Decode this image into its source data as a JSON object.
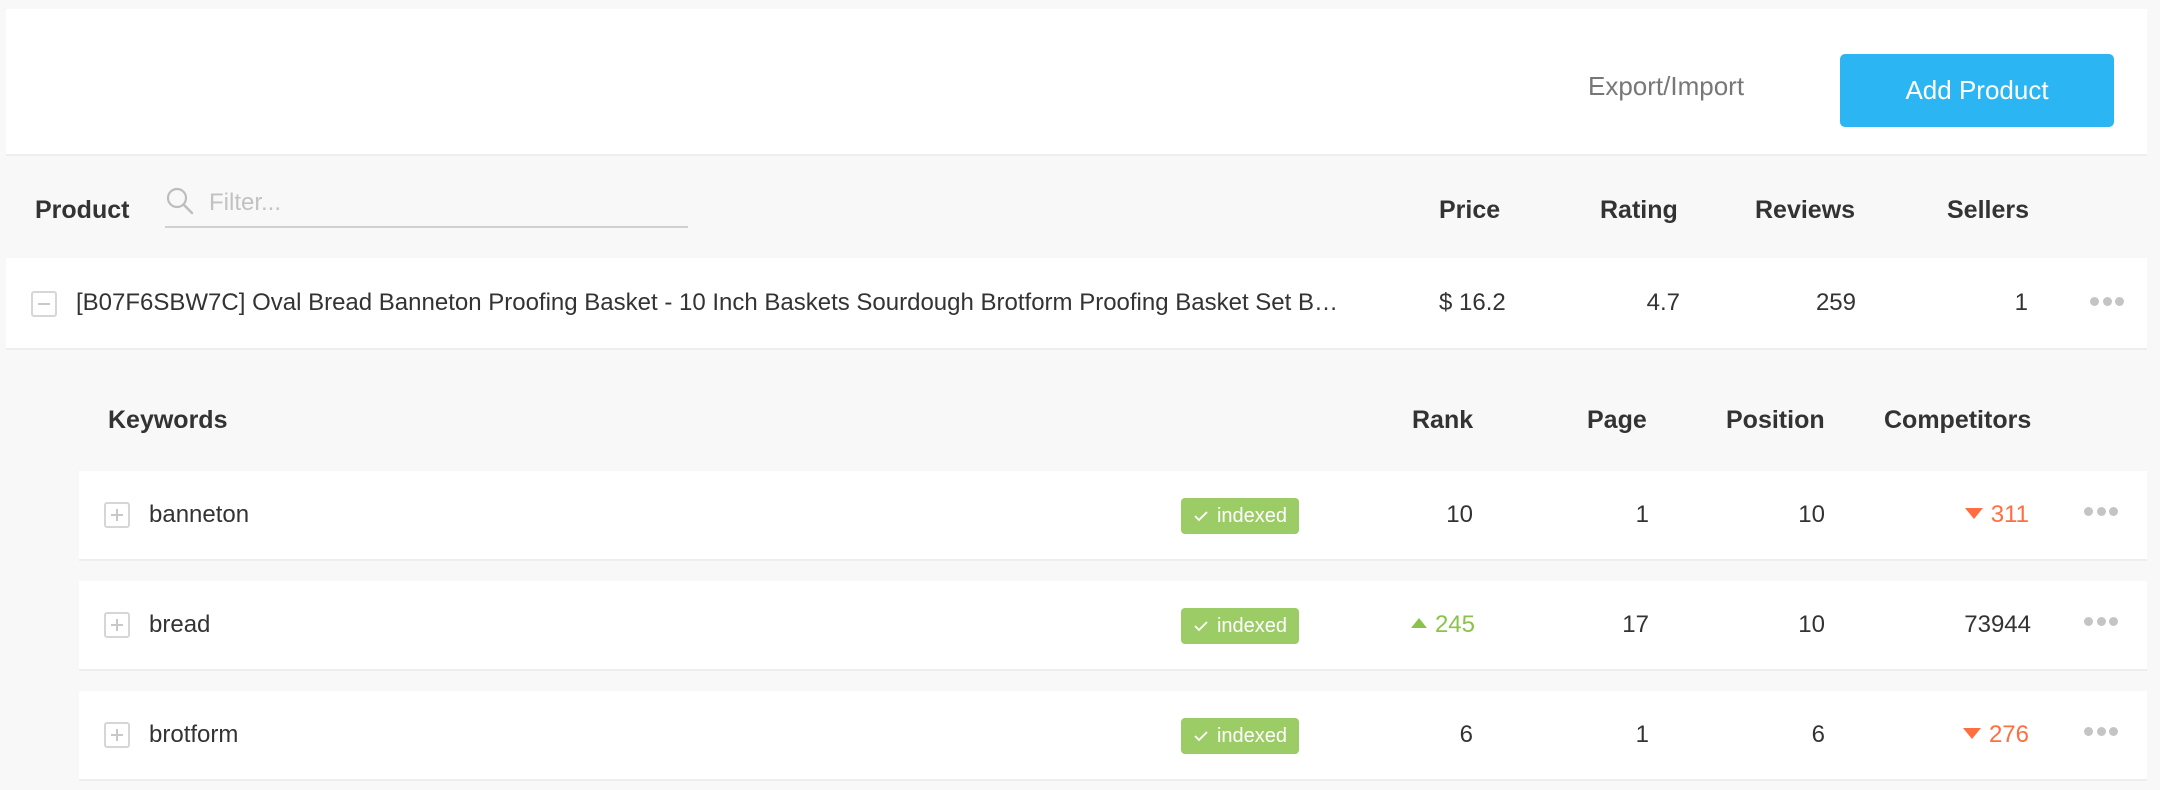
{
  "toolbar": {
    "export_label": "Export/Import",
    "add_label": "Add Product"
  },
  "products_table": {
    "headers": {
      "product": "Product",
      "price": "Price",
      "rating": "Rating",
      "reviews": "Reviews",
      "sellers": "Sellers"
    },
    "filter": {
      "placeholder": "Filter...",
      "value": ""
    },
    "rows": [
      {
        "expanded": true,
        "title": "[B07F6SBW7C] Oval Bread Banneton Proofing Basket - 10 Inch Baskets Sourdough Brotform Proofing Basket Set Ban...",
        "price": "$ 16.2",
        "rating": "4.7",
        "reviews": "259",
        "sellers": "1"
      }
    ]
  },
  "keywords_table": {
    "headers": {
      "keyword": "Keywords",
      "rank": "Rank",
      "page": "Page",
      "position": "Position",
      "competitors": "Competitors"
    },
    "rows": [
      {
        "keyword": "banneton",
        "status": "indexed",
        "rank": "10",
        "rank_trend": "none",
        "page": "1",
        "position": "10",
        "competitors": "311",
        "competitors_trend": "down"
      },
      {
        "keyword": "bread",
        "status": "indexed",
        "rank": "245",
        "rank_trend": "up",
        "page": "17",
        "position": "10",
        "competitors": "73944",
        "competitors_trend": "none"
      },
      {
        "keyword": "brotform",
        "status": "indexed",
        "rank": "6",
        "rank_trend": "none",
        "page": "1",
        "position": "6",
        "competitors": "276",
        "competitors_trend": "down"
      }
    ]
  },
  "colors": {
    "primary": "#2bb5f3",
    "indexed_badge": "#9ccc65",
    "trend_up": "#8bc34a",
    "trend_down": "#ff6e40"
  }
}
